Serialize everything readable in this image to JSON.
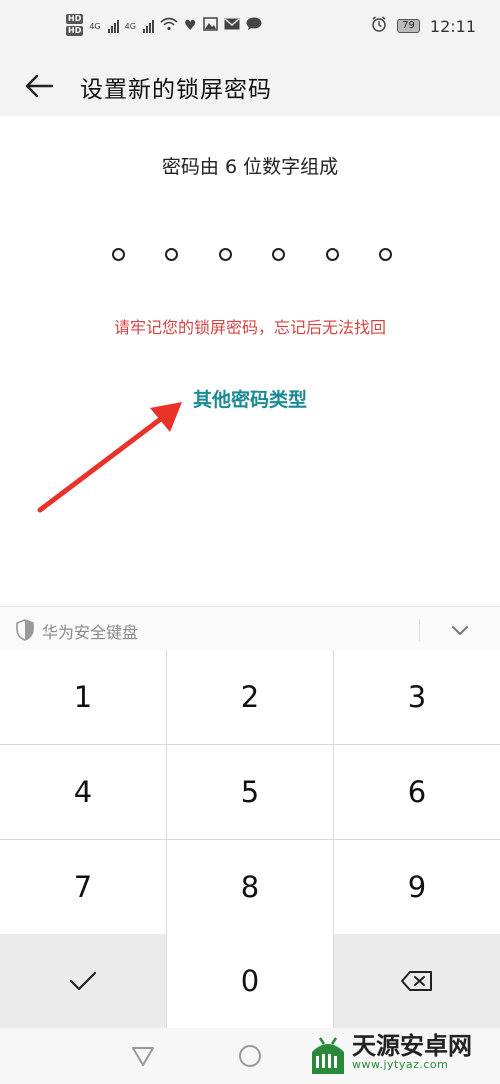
{
  "status_bar": {
    "network_labels": [
      "4G",
      "4G"
    ],
    "battery_level": "79",
    "time": "12:11",
    "icons": [
      "hd-icon",
      "signal-icon",
      "wifi-icon",
      "health-icon",
      "gallery-icon",
      "mail-icon",
      "message-icon",
      "alarm-icon",
      "battery-icon"
    ]
  },
  "header": {
    "title": "设置新的锁屏密码"
  },
  "main": {
    "subtitle": "密码由 6 位数字组成",
    "pin_length": 6,
    "warning": "请牢记您的锁屏密码，忘记后无法找回",
    "other_types_link": "其他密码类型"
  },
  "keyboard": {
    "label": "华为安全键盘",
    "keys": [
      "1",
      "2",
      "3",
      "4",
      "5",
      "6",
      "7",
      "8",
      "9",
      "0"
    ]
  },
  "watermark": {
    "name": "天源安卓网",
    "url": "www.jytyaz.com"
  },
  "colors": {
    "warning": "#d64545",
    "link": "#1a8a94",
    "arrow": "#e8322a",
    "watermark_green": "#2a8a3a"
  }
}
